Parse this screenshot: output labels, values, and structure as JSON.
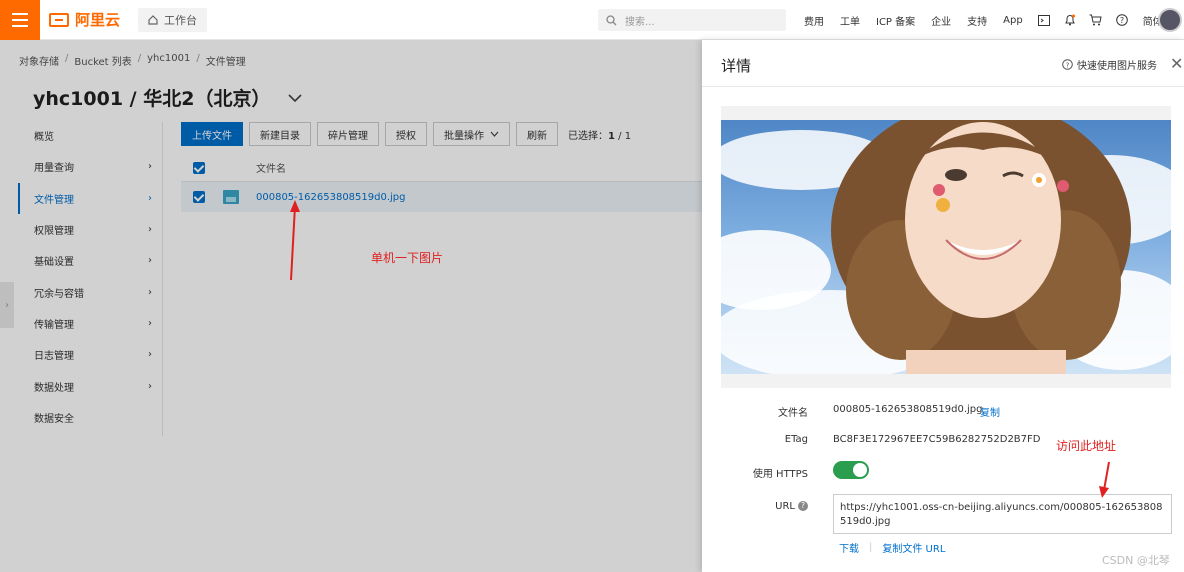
{
  "topbar": {
    "logo": "阿里云",
    "workbench": "工作台",
    "search_placeholder": "搜索...",
    "nav": [
      "费用",
      "工单",
      "ICP 备案",
      "企业",
      "支持",
      "App"
    ],
    "lang": "简体",
    "colors": {
      "brand": "#ff6a00"
    }
  },
  "breadcrumb": [
    "对象存储",
    "Bucket 列表",
    "yhc1001",
    "文件管理"
  ],
  "bucket_title": "yhc1001 / 华北2（北京）",
  "sidebar": {
    "items": [
      {
        "label": "概览",
        "has_arrow": false
      },
      {
        "label": "用量查询",
        "has_arrow": true
      },
      {
        "label": "文件管理",
        "has_arrow": true,
        "active": true
      },
      {
        "label": "权限管理",
        "has_arrow": true
      },
      {
        "label": "基础设置",
        "has_arrow": true
      },
      {
        "label": "冗余与容错",
        "has_arrow": true
      },
      {
        "label": "传输管理",
        "has_arrow": true
      },
      {
        "label": "日志管理",
        "has_arrow": true
      },
      {
        "label": "数据处理",
        "has_arrow": true
      },
      {
        "label": "数据安全",
        "has_arrow": false
      }
    ]
  },
  "toolbar": {
    "upload": "上传文件",
    "new_dir": "新建目录",
    "fragments": "碎片管理",
    "authorize": "授权",
    "batch": "批量操作",
    "refresh": "刷新",
    "selected_label": "已选择：",
    "selected_count": "1",
    "selected_sep": "/",
    "selected_total": "1"
  },
  "table": {
    "header_filename": "文件名",
    "row_filename": "000805-162653808519d0.jpg"
  },
  "annotations": {
    "click_image": "单机一下图片",
    "visit_url": "访问此地址"
  },
  "drawer": {
    "title": "详情",
    "help": "快速使用图片服务",
    "filename_label": "文件名",
    "filename_value": "000805-162653808519d0.jpg",
    "copy": "复制",
    "etag_label": "ETag",
    "etag_value": "BC8F3E172967EE7C59B6282752D2B7FD",
    "https_label": "使用 HTTPS",
    "https_enabled": true,
    "url_label": "URL",
    "url_value": "https://yhc1001.oss-cn-beijing.aliyuncs.com/000805-162653808519d0.jpg",
    "download": "下载",
    "copy_url": "复制文件 URL"
  },
  "watermark": "CSDN @北琴"
}
